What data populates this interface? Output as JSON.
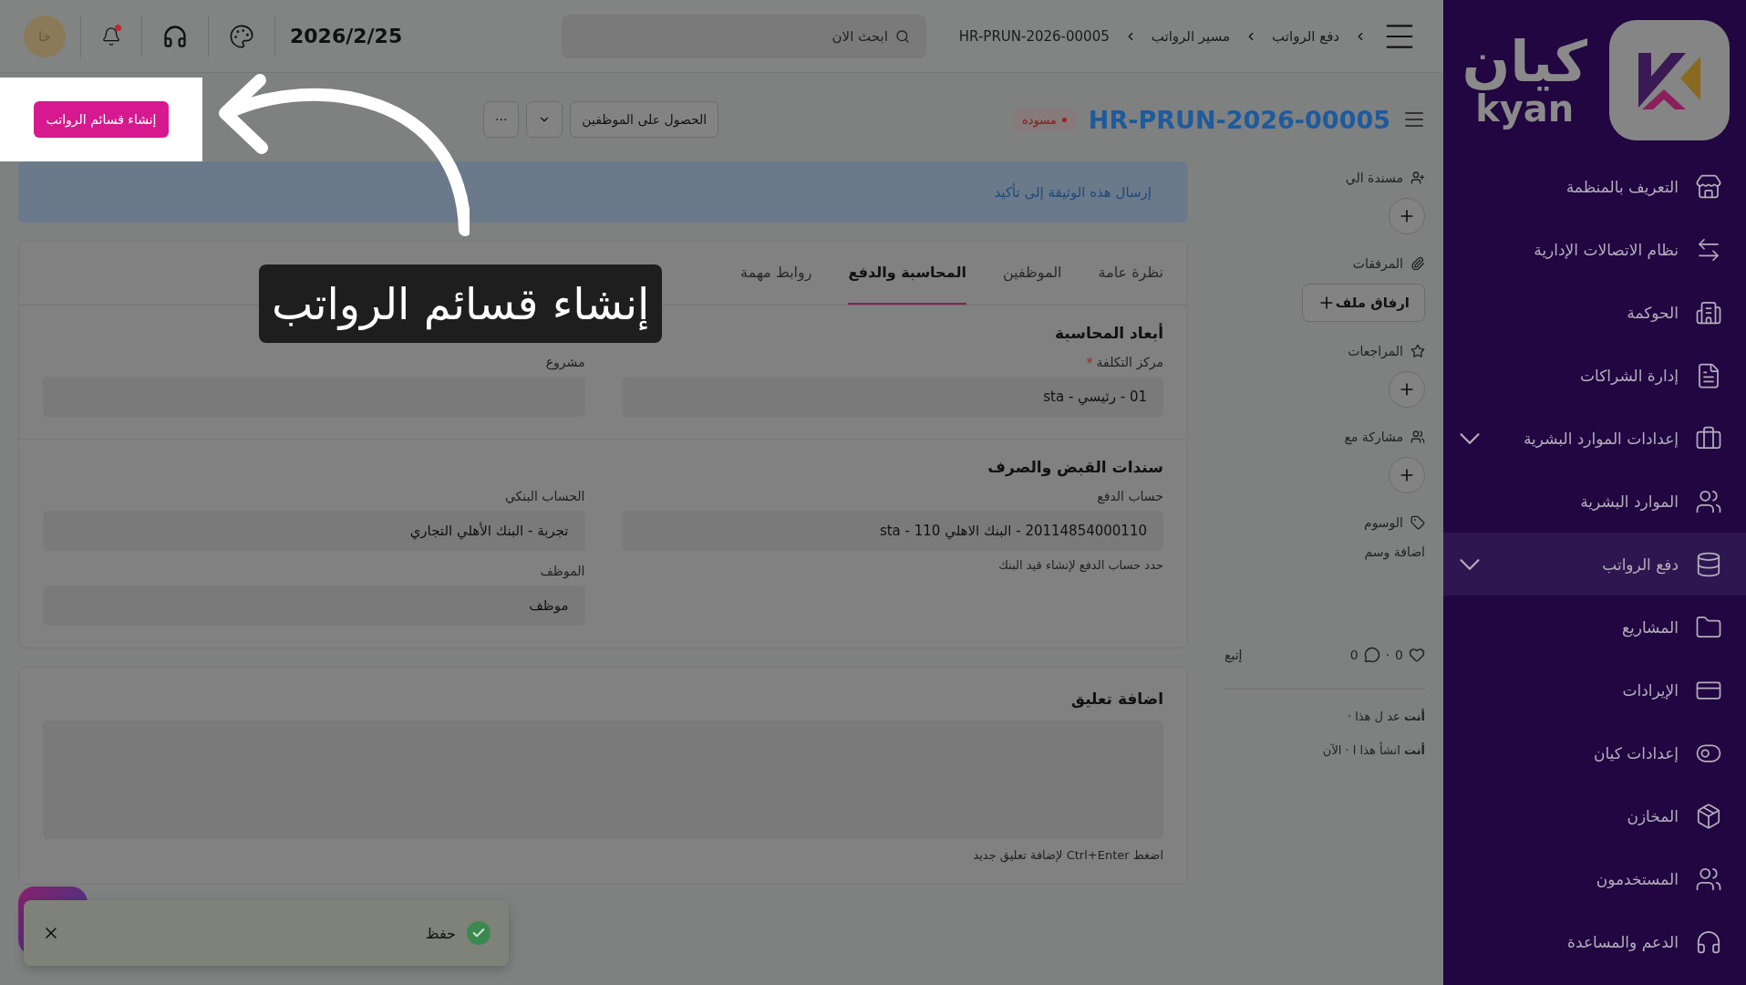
{
  "sidebar": {
    "logo": {
      "arabic": "كيان",
      "latin": "kyan"
    },
    "items": [
      {
        "label": "التعريف بالمنظمة",
        "has_submenu": false,
        "selected": false
      },
      {
        "label": "نظام الاتصالات الإدارية",
        "has_submenu": false,
        "selected": false
      },
      {
        "label": "الحوكمة",
        "has_submenu": false,
        "selected": false
      },
      {
        "label": "إدارة الشراكات",
        "has_submenu": false,
        "selected": false
      },
      {
        "label": "إعدادات الموارد البشرية",
        "has_submenu": true,
        "selected": false
      },
      {
        "label": "الموارد البشرية",
        "has_submenu": false,
        "selected": false
      },
      {
        "label": "دفع الرواتب",
        "has_submenu": true,
        "selected": true
      },
      {
        "label": "المشاريع",
        "has_submenu": false,
        "selected": false
      },
      {
        "label": "الإيرادات",
        "has_submenu": false,
        "selected": false
      },
      {
        "label": "إعدادات كيان",
        "has_submenu": false,
        "selected": false
      },
      {
        "label": "المخازن",
        "has_submenu": false,
        "selected": false
      },
      {
        "label": "المستخدمون",
        "has_submenu": false,
        "selected": false
      },
      {
        "label": "الدعم والمساعدة",
        "has_submenu": false,
        "selected": false
      }
    ]
  },
  "topbar": {
    "breadcrumbs": [
      "دفع الرواتب",
      "مسير الرواتب",
      "HR-PRUN-2026-00005"
    ],
    "search": {
      "placeholder": "ابحث الان"
    },
    "date": "2026/2/25",
    "notification_unread": true,
    "avatar": "خا"
  },
  "document": {
    "title": "HR-PRUN-2026-00005",
    "status": "مسوده",
    "actions": [
      {
        "kind": "button",
        "label": "الحصول على الموظفين"
      },
      {
        "kind": "dropdown"
      },
      {
        "kind": "more",
        "label": "···"
      }
    ],
    "primary_action": "إنشاء قسائم الرواتب"
  },
  "banner": "إرسال هذه الوثيقة إلى تأكيد",
  "tabs": [
    {
      "label": "نظرة عامة",
      "selected": false
    },
    {
      "label": "الموظفين",
      "selected": false
    },
    {
      "label": "المحاسبة والدفع",
      "selected": true
    },
    {
      "label": "روابط مهمة",
      "selected": false
    }
  ],
  "sections": [
    {
      "title": "أبعاد المحاسبة",
      "columns": [
        [
          {
            "label": "مركز التكلفة",
            "required_mark": "*",
            "value": "01 - رئيسي - sta"
          }
        ],
        [
          {
            "label": "مشروع"
          }
        ]
      ]
    },
    {
      "title": "سندات القبض والصرف",
      "columns": [
        [
          {
            "label": "حساب الدفع",
            "value": "20114854000110 - البنك الاهلي 110 - sta",
            "hint": "حدد حساب الدفع لإنشاء قيد البنك"
          }
        ],
        [
          {
            "label": "الحساب البنكي",
            "value": "تجربة - البنك الأهلي التجاري"
          },
          {
            "label": "الموظف",
            "value": "موظف"
          }
        ]
      ]
    }
  ],
  "comment": {
    "title": "اضافة تعليق",
    "hint": "اضغط Ctrl+Enter لإضافة تعليق جديد"
  },
  "meta": [
    {
      "kind": "add",
      "label": "مسندة الي"
    },
    {
      "kind": "attach",
      "label": "المرفقات",
      "action": "ارفاق ملف"
    },
    {
      "kind": "add",
      "label": "المراجعات"
    },
    {
      "kind": "add",
      "label": "مشاركة مع"
    },
    {
      "kind": "tags",
      "label": "الوسوم",
      "action": "اضافة وسم"
    }
  ],
  "social": {
    "likes": "0",
    "separator": "·",
    "comments": "0",
    "follow": "إتبع"
  },
  "activity": [
    "**أنت** عد ل هذا ·",
    "**أنت** انشأ هذا ا · الآن"
  ],
  "toast": {
    "message": "حفظ"
  },
  "tour": {
    "caption": "إنشاء قسائم الرواتب"
  }
}
